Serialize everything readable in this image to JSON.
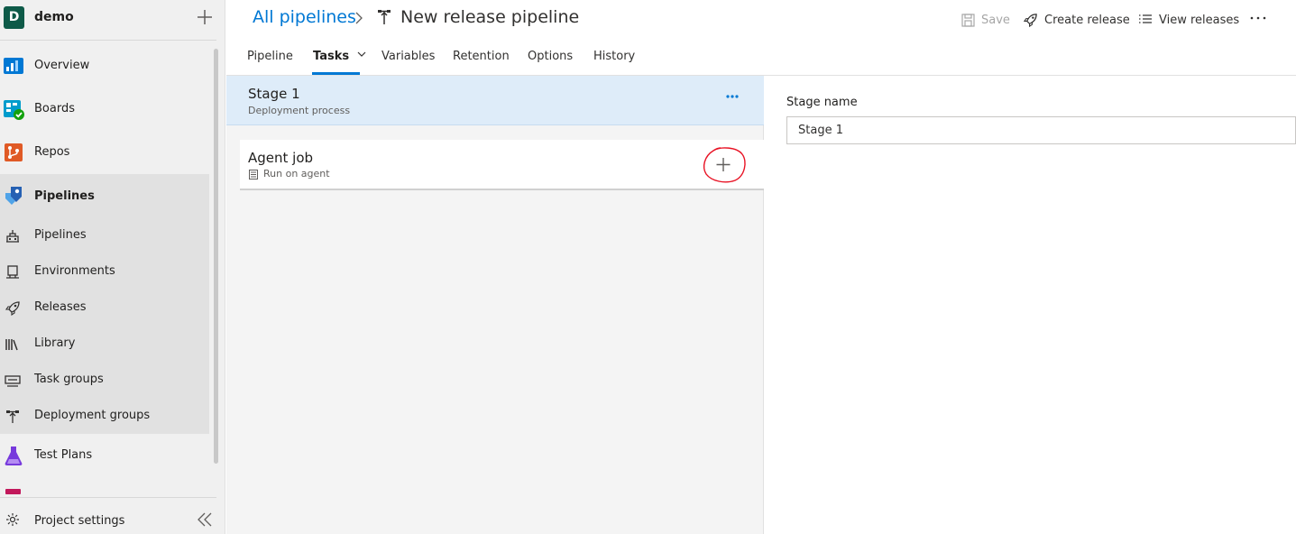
{
  "project": {
    "initial": "D",
    "name": "demo"
  },
  "sidebar": {
    "items": [
      {
        "label": "Overview"
      },
      {
        "label": "Boards"
      },
      {
        "label": "Repos"
      },
      {
        "label": "Pipelines"
      }
    ],
    "pipelines_sub": [
      {
        "label": "Pipelines"
      },
      {
        "label": "Environments"
      },
      {
        "label": "Releases"
      },
      {
        "label": "Library"
      },
      {
        "label": "Task groups"
      },
      {
        "label": "Deployment groups"
      }
    ],
    "test_plans": "Test Plans",
    "settings": "Project settings"
  },
  "header": {
    "breadcrumb_root": "All pipelines",
    "title": "New release pipeline",
    "save": "Save",
    "create_release": "Create release",
    "view_releases": "View releases"
  },
  "tabs": [
    {
      "label": "Pipeline"
    },
    {
      "label": "Tasks"
    },
    {
      "label": "Variables"
    },
    {
      "label": "Retention"
    },
    {
      "label": "Options"
    },
    {
      "label": "History"
    }
  ],
  "stage": {
    "title": "Stage 1",
    "subtitle": "Deployment process"
  },
  "job": {
    "title": "Agent job",
    "subtitle": "Run on agent"
  },
  "panel": {
    "field_label": "Stage name",
    "field_value": "Stage 1"
  },
  "colors": {
    "accent": "#0078d4",
    "annotation": "#e81123",
    "stage_bg": "#deecf9"
  }
}
